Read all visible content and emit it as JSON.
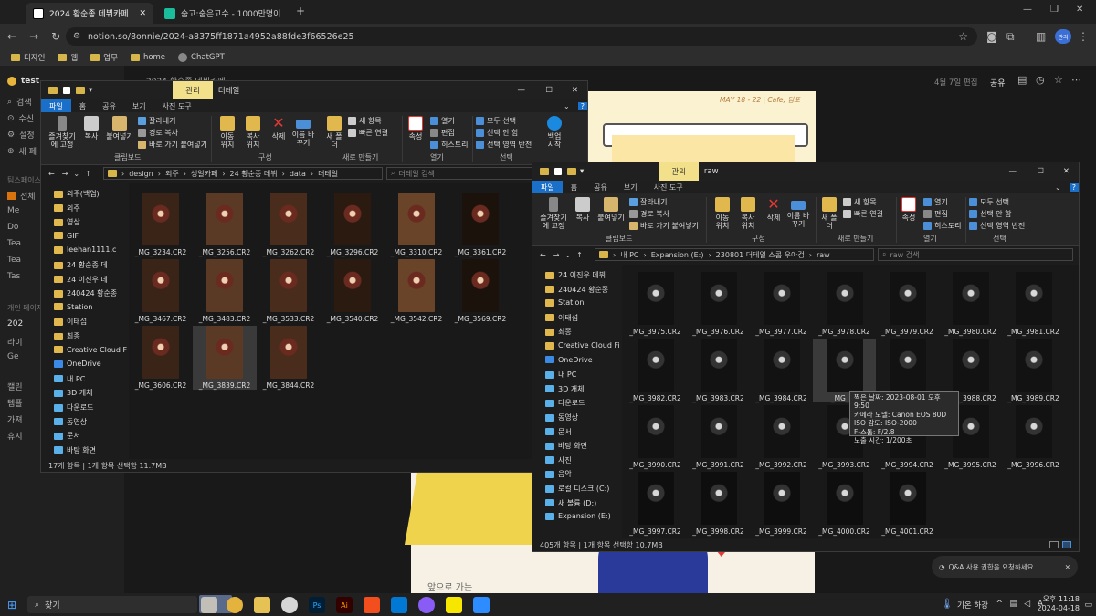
{
  "browser": {
    "tabs": [
      {
        "label": "2024 황순종 데뷔카페",
        "active": true
      },
      {
        "label": "숨고:숨은고수 - 1000만명이 선"
      }
    ],
    "url": "notion.so/8onnie/2024-a8375ff1871a4952a88fde3f66526e25",
    "profile": "관리",
    "bookmarks": [
      "디자인",
      "웹",
      "업무",
      "home",
      "ChatGPT"
    ]
  },
  "notion": {
    "workspace": "test",
    "side_items": [
      "검색",
      "수신",
      "설정",
      "새 페",
      "팀스페이스",
      "전체",
      "Me",
      "Do",
      "Tea",
      "Tea",
      "Tas",
      "개인 페이지",
      "202",
      "라이",
      "Ge",
      "캘린",
      "템플",
      "가져",
      "휴지"
    ],
    "breadcrumb": "2024 황순종 데뷔카페",
    "edited": "4월 7일 편집",
    "share": "공유",
    "poster_text": "MAY 18 - 22 | Cafe, 딤포",
    "bottom_text": "앞으로 가는",
    "help": "Q&A 사용 권한을 요청하세요."
  },
  "left_win": {
    "title_tab": "관리",
    "title_extra": "더테일",
    "tabs": [
      "파일",
      "홈",
      "공유",
      "보기",
      "사진 도구"
    ],
    "ribbon": {
      "pin": "즐겨찾기에 고정",
      "copy": "복사",
      "paste": "붙여넣기",
      "cut": "잘라내기",
      "copy_path": "경로 복사",
      "paste_shortcut": "바로 가기 붙여넣기",
      "move": "이동 위치",
      "copyto": "복사 위치",
      "delete": "삭제",
      "rename": "이름 바꾸기",
      "newfolder": "새 폴더",
      "newitem": "새 항목",
      "easy": "빠른 연결",
      "props": "속성",
      "open": "열기",
      "edit": "편집",
      "history": "히스토리",
      "selall": "모두 선택",
      "selnone": "선택 안 함",
      "invert": "선택 영역 반전",
      "backup": "백업 시작",
      "g1": "클립보드",
      "g2": "구성",
      "g3": "새로 만들기",
      "g4": "열기",
      "g5": "선택"
    },
    "path": [
      "design",
      "외주",
      "생일카페",
      "24 황순종 데뷔",
      "data",
      "더테일"
    ],
    "search": "더테일 검색",
    "tree": [
      "외주(백업)",
      "외주",
      "영상",
      "GIF",
      "leehan1111.c",
      "24 황순종 데",
      "24 이진우 데",
      "240424 황순종",
      "Station",
      "이태섭",
      "최종",
      "Creative Cloud Fil",
      "OneDrive",
      "내 PC",
      "3D 개체",
      "다운로드",
      "동영상",
      "문서",
      "바탕 화면"
    ],
    "files": [
      "_MG_3234.CR2",
      "_MG_3256.CR2",
      "_MG_3262.CR2",
      "_MG_3296.CR2",
      "_MG_3310.CR2",
      "_MG_3361.CR2",
      "_MG_3467.CR2",
      "_MG_3483.CR2",
      "_MG_3533.CR2",
      "_MG_3540.CR2",
      "_MG_3542.CR2",
      "_MG_3569.CR2",
      "_MG_3606.CR2",
      "_MG_3839.CR2",
      "_MG_3844.CR2"
    ],
    "status": "17개 항목 | 1개 항목 선택함 11.7MB"
  },
  "right_win": {
    "title_tab": "관리",
    "title_extra": "raw",
    "tabs": [
      "파일",
      "홈",
      "공유",
      "보기",
      "사진 도구"
    ],
    "path": [
      "내 PC",
      "Expansion (E:)",
      "230801 더테일 스콥 우아검",
      "raw"
    ],
    "search": "raw 검색",
    "tree": [
      "24 이진우 데뷔",
      "240424 황순종",
      "Station",
      "이태섭",
      "최종",
      "Creative Cloud Fil",
      "OneDrive",
      "내 PC",
      "3D 개체",
      "다운로드",
      "동영상",
      "문서",
      "바탕 화면",
      "사진",
      "음악",
      "로컬 디스크 (C:)",
      "새 볼륨 (D:)",
      "Expansion (E:)"
    ],
    "files": [
      "_MG_3975.CR2",
      "_MG_3976.CR2",
      "_MG_3977.CR2",
      "_MG_3978.CR2",
      "_MG_3979.CR2",
      "_MG_3980.CR2",
      "_MG_3981.CR2",
      "_MG_3982.CR2",
      "_MG_3983.CR2",
      "_MG_3984.CR2",
      "_MG_39",
      "_MG_3987.CR2",
      "_MG_3988.CR2",
      "_MG_3989.CR2",
      "_MG_3990.CR2",
      "_MG_3991.CR2",
      "_MG_3992.CR2",
      "_MG_3993.CR2",
      "_MG_3994.CR2",
      "_MG_3995.CR2",
      "_MG_3996.CR2",
      "_MG_3997.CR2",
      "_MG_3998.CR2",
      "_MG_3999.CR2",
      "_MG_4000.CR2",
      "_MG_4001.CR2"
    ],
    "status": "405개 항목 | 1개 항목 선택함 10.7MB",
    "tooltip": [
      "찍은 날짜: 2023-08-01 오후 9:50",
      "카메라 모델: Canon EOS 80D",
      "ISO 감도: ISO-2000",
      "F-스톱: F/2.8",
      "노출 시간: 1/200초"
    ]
  },
  "taskbar": {
    "search": "찾기",
    "weather": "기온 하강",
    "time": "오후 11:18",
    "date": "2024-04-18",
    "ime": "A"
  }
}
